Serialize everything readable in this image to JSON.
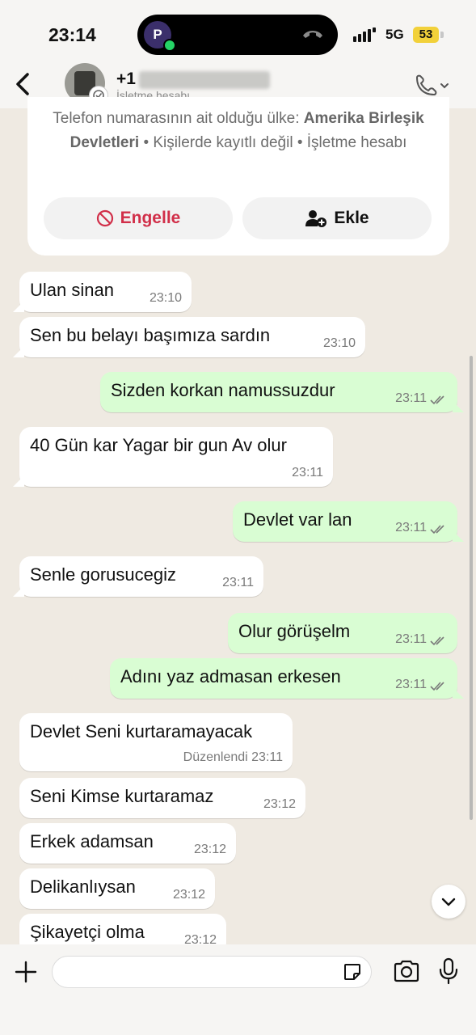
{
  "status_bar": {
    "time": "23:14",
    "island_avatar_letter": "P",
    "network": "5G",
    "battery": "53"
  },
  "header": {
    "contact_name": "+1",
    "contact_subtitle": "İşletme hesabı",
    "icons": [
      "back-chevron-icon",
      "phone-icon",
      "chevron-down-icon"
    ]
  },
  "info_card": {
    "line_prefix": "Telefon numarasının ait olduğu ülke: ",
    "country": "Amerika Birleşik Devletleri",
    "line_suffix": " • Kişilerde kayıtlı değil • İşletme hesabı",
    "block_label": "Engelle",
    "add_label": "Ekle"
  },
  "messages": [
    {
      "dir": "in",
      "text": "Ulan sinan",
      "time": "23:10"
    },
    {
      "dir": "in",
      "text": "Sen bu belayı başımıza sardın",
      "time": "23:10"
    },
    {
      "dir": "out",
      "text": "Sizden korkan namussuzdur",
      "time": "23:11"
    },
    {
      "dir": "in",
      "text": "40 Gün kar Yagar bir gun Av olur",
      "time": "23:11"
    },
    {
      "dir": "out",
      "text": "Devlet var lan",
      "time": "23:11"
    },
    {
      "dir": "in",
      "text": "Senle gorusucegiz",
      "time": "23:11"
    },
    {
      "dir": "out",
      "text": "Olur görüşelm",
      "time": "23:11"
    },
    {
      "dir": "out",
      "text": "Adını yaz admasan erkesen",
      "time": "23:11"
    },
    {
      "dir": "in",
      "text": "Devlet Seni kurtaramayacak",
      "time": "Düzenlendi 23:11"
    },
    {
      "dir": "in",
      "text": "Seni Kimse kurtaramaz",
      "time": "23:12"
    },
    {
      "dir": "in",
      "text": "Erkek adamsan",
      "time": "23:12"
    },
    {
      "dir": "in",
      "text": "Delikanlıysan",
      "time": "23:12"
    },
    {
      "dir": "in",
      "text": "Şikayetçi olma",
      "time": "23:12"
    }
  ],
  "input": {
    "value": "",
    "placeholder": ""
  },
  "colors": {
    "chat_background": "#efeae2",
    "outgoing_bubble": "#d9fdd3",
    "incoming_bubble": "#ffffff",
    "block_red": "#d12f49",
    "read_check": "#7a7a7a"
  }
}
